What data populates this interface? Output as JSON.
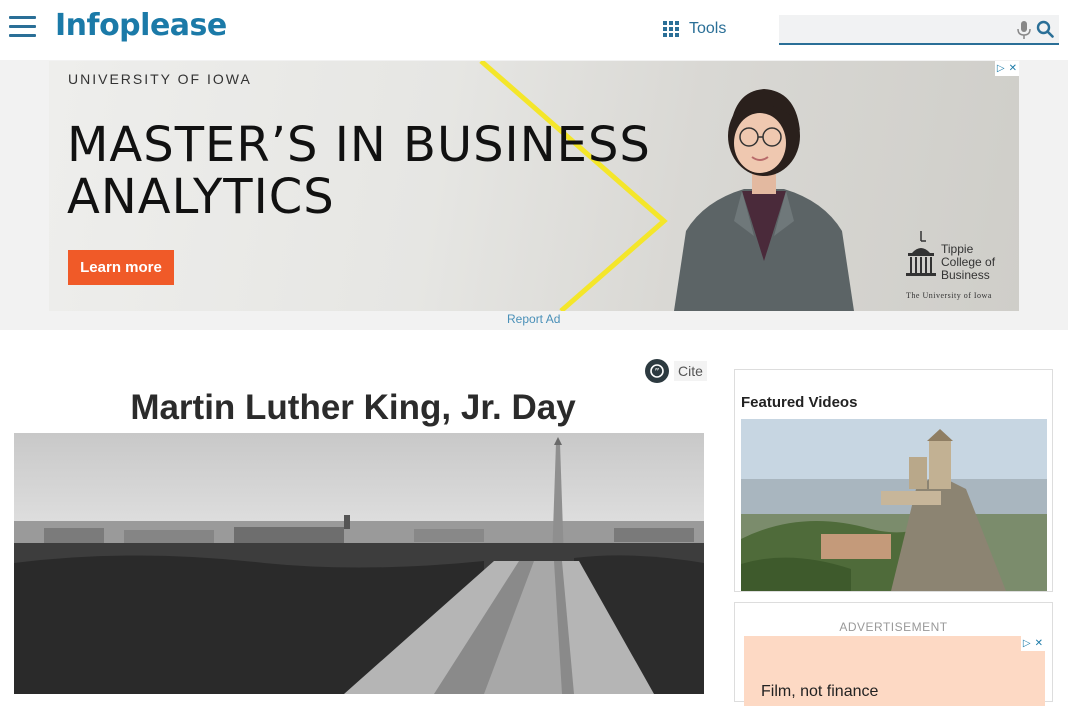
{
  "header": {
    "logo": "Infoplease",
    "tools_label": "Tools",
    "search_placeholder": ""
  },
  "top_ad": {
    "university": "UNIVERSITY OF IOWA",
    "headline_line1": "MASTER’S IN BUSINESS",
    "headline_line2": "ANALYTICS",
    "cta": "Learn more",
    "brand_line1": "Tippie",
    "brand_line2": "College of",
    "brand_line3": "Business",
    "brand_sub": "The University of Iowa",
    "report_ad": "Report Ad"
  },
  "article": {
    "cite_label": "Cite",
    "title": "Martin Luther King, Jr. Day"
  },
  "sidebar": {
    "featured_title": "Featured Videos",
    "ad_label": "ADVERTISEMENT",
    "ad_text": "Film, not finance"
  },
  "colors": {
    "brand_blue": "#1b7aa8",
    "cta_orange": "#f05a28",
    "ad_yellow": "#f4e62a"
  }
}
